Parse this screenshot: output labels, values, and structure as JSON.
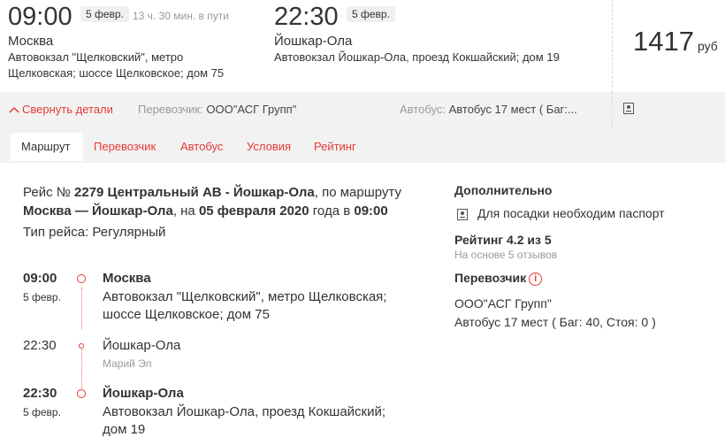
{
  "departure": {
    "time": "09:00",
    "date": "5 февр.",
    "duration": "13 ч. 30 мин. в пути",
    "city": "Москва",
    "address_line1": "Автовокзал \"Щелковский\", метро",
    "address_line2": "Щелковская; шоссе Щелковское; дом 75"
  },
  "arrival": {
    "time": "22:30",
    "date": "5 февр.",
    "city": "Йошкар-Ола",
    "address": "Автовокзал Йошкар-Ола, проезд Кокшайский; дом 19"
  },
  "price": {
    "amount": "1417",
    "currency": "руб"
  },
  "band": {
    "collapse_label": "Свернуть детали",
    "carrier_label": "Перевозчик:",
    "carrier_value": "ООО\"АСГ Групп\"",
    "bus_label": "Автобус:",
    "bus_value": "Автобус 17 мест ( Баг:..."
  },
  "tabs": [
    {
      "label": "Маршрут",
      "active": true
    },
    {
      "label": "Перевозчик",
      "active": false
    },
    {
      "label": "Автобус",
      "active": false
    },
    {
      "label": "Условия",
      "active": false
    },
    {
      "label": "Рейтинг",
      "active": false
    }
  ],
  "trip": {
    "prefix": "Рейс № ",
    "number_name": "2279 Центральный АВ - Йошкар-Ола",
    "middle": ", по маршруту",
    "route": "Москва — Йошкар-Ола",
    "on": ", на ",
    "date": "05 февраля 2020",
    "at": " года в ",
    "time": "09:00",
    "type": "Тип рейса: Регулярный"
  },
  "stops": [
    {
      "time": "09:00",
      "date": "5 февр.",
      "city": "Москва",
      "address_line1": "Автовокзал \"Щелковский\", метро Щелковская;",
      "address_line2": "шоссе Щелковское; дом 75"
    },
    {
      "time": "22:30",
      "city": "Йошкар-Ола",
      "region": "Марий Эл"
    },
    {
      "time": "22:30",
      "date": "5 февр.",
      "city": "Йошкар-Ола",
      "address_line1": "Автовокзал Йошкар-Ола, проезд Кокшайский;",
      "address_line2": "дом 19"
    }
  ],
  "sidebar": {
    "extra_title": "Дополнительно",
    "passport_note": "Для посадки необходим паспорт",
    "rating_title": "Рейтинг 4.2 из 5",
    "rating_sub": "На основе 5 отзывов",
    "carrier_title": "Перевозчик",
    "carrier_name": "ООО\"АСГ Групп\"",
    "bus_info": "Автобус 17 мест ( Баг: 40, Стоя: 0 )"
  },
  "colors": {
    "accent": "#e53935",
    "band_bg": "#f2f2f2",
    "muted_text": "#999999"
  },
  "icons": [
    "chevron-up-icon",
    "passport-icon",
    "info-icon"
  ]
}
